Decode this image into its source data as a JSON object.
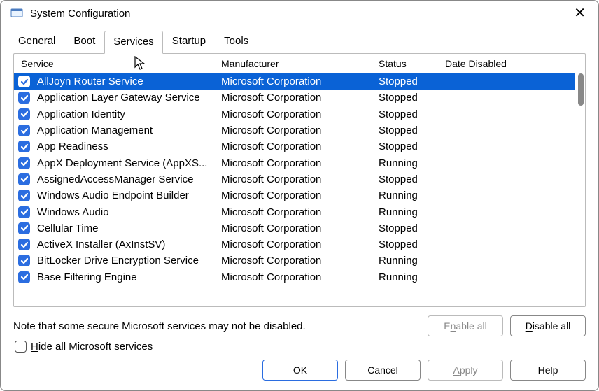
{
  "window": {
    "title": "System Configuration",
    "close_label": "✕"
  },
  "tabs": {
    "items": [
      "General",
      "Boot",
      "Services",
      "Startup",
      "Tools"
    ],
    "active": 2
  },
  "columns": {
    "service": "Service",
    "manufacturer": "Manufacturer",
    "status": "Status",
    "date_disabled": "Date Disabled"
  },
  "rows": [
    {
      "checked": true,
      "selected": true,
      "service": "AllJoyn Router Service",
      "manufacturer": "Microsoft Corporation",
      "status": "Stopped",
      "date": ""
    },
    {
      "checked": true,
      "selected": false,
      "service": "Application Layer Gateway Service",
      "manufacturer": "Microsoft Corporation",
      "status": "Stopped",
      "date": ""
    },
    {
      "checked": true,
      "selected": false,
      "service": "Application Identity",
      "manufacturer": "Microsoft Corporation",
      "status": "Stopped",
      "date": ""
    },
    {
      "checked": true,
      "selected": false,
      "service": "Application Management",
      "manufacturer": "Microsoft Corporation",
      "status": "Stopped",
      "date": ""
    },
    {
      "checked": true,
      "selected": false,
      "service": "App Readiness",
      "manufacturer": "Microsoft Corporation",
      "status": "Stopped",
      "date": ""
    },
    {
      "checked": true,
      "selected": false,
      "service": "AppX Deployment Service (AppXS...",
      "manufacturer": "Microsoft Corporation",
      "status": "Running",
      "date": ""
    },
    {
      "checked": true,
      "selected": false,
      "service": "AssignedAccessManager Service",
      "manufacturer": "Microsoft Corporation",
      "status": "Stopped",
      "date": ""
    },
    {
      "checked": true,
      "selected": false,
      "service": "Windows Audio Endpoint Builder",
      "manufacturer": "Microsoft Corporation",
      "status": "Running",
      "date": ""
    },
    {
      "checked": true,
      "selected": false,
      "service": "Windows Audio",
      "manufacturer": "Microsoft Corporation",
      "status": "Running",
      "date": ""
    },
    {
      "checked": true,
      "selected": false,
      "service": "Cellular Time",
      "manufacturer": "Microsoft Corporation",
      "status": "Stopped",
      "date": ""
    },
    {
      "checked": true,
      "selected": false,
      "service": "ActiveX Installer (AxInstSV)",
      "manufacturer": "Microsoft Corporation",
      "status": "Stopped",
      "date": ""
    },
    {
      "checked": true,
      "selected": false,
      "service": "BitLocker Drive Encryption Service",
      "manufacturer": "Microsoft Corporation",
      "status": "Running",
      "date": ""
    },
    {
      "checked": true,
      "selected": false,
      "service": "Base Filtering Engine",
      "manufacturer": "Microsoft Corporation",
      "status": "Running",
      "date": ""
    }
  ],
  "note": "Note that some secure Microsoft services may not be disabled.",
  "buttons": {
    "enable_all_pre": "E",
    "enable_all_u": "n",
    "enable_all_post": "able all",
    "disable_all_u": "D",
    "disable_all_post": "isable all",
    "hide_u": "H",
    "hide_post": "ide all Microsoft services",
    "ok": "OK",
    "cancel": "Cancel",
    "apply_u": "A",
    "apply_post": "pply",
    "help": "Help"
  }
}
